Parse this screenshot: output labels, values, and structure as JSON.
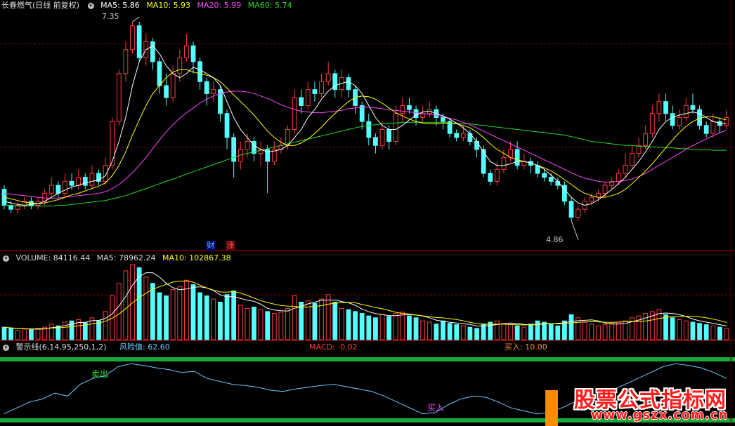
{
  "stock": {
    "name": "长春燃气",
    "mode": "(日线 前复权)"
  },
  "price_panel": {
    "ma5_label": "MA5: 5.86",
    "ma10_label": "MA10: 5.93",
    "ma20_label": "MA20: 5.99",
    "ma60_label": "MA60: 5.74",
    "high_label": "7.35",
    "low_label": "4.86",
    "event_labels": [
      "财",
      "涨"
    ]
  },
  "volume_panel": {
    "volume_label": "VOLUME: 84116.44",
    "ma5_label": "MA5: 78962.24",
    "ma10_label": "MA10: 102867.38"
  },
  "indicator_panel": {
    "name": "警示线(6,14,95,250,1,2)",
    "risk_label": "风险值: 62.60",
    "macd_label": "MACD: -0.02",
    "buy_label": "买入: 10.00",
    "sell_text": "卖出",
    "buy_text": "买入"
  },
  "watermark": {
    "line1": "股票公式指标网",
    "line2": "www.gszx.com.cn"
  },
  "colors": {
    "up": "#ff3b3b",
    "down": "#54ffff",
    "ma5": "#ffffff",
    "ma10": "#ffff00",
    "ma20": "#ff44ff",
    "ma60": "#22dd22",
    "risk": "#6ec8ff",
    "grid": "#8b0000"
  },
  "chart_data": {
    "type": "candlestick",
    "ylim": [
      4.5,
      7.5
    ],
    "candles": [
      [
        5.25,
        5.05,
        5.3,
        5.0
      ],
      [
        5.05,
        5.0,
        5.1,
        4.95
      ],
      [
        5.0,
        5.05,
        5.1,
        4.95
      ],
      [
        5.05,
        5.1,
        5.15,
        5.0
      ],
      [
        5.1,
        5.05,
        5.15,
        5.0
      ],
      [
        5.05,
        5.1,
        5.15,
        5.0
      ],
      [
        5.1,
        5.2,
        5.25,
        5.05
      ],
      [
        5.2,
        5.3,
        5.4,
        5.15
      ],
      [
        5.3,
        5.2,
        5.35,
        5.15
      ],
      [
        5.2,
        5.35,
        5.45,
        5.15
      ],
      [
        5.35,
        5.3,
        5.45,
        5.25
      ],
      [
        5.3,
        5.4,
        5.5,
        5.25
      ],
      [
        5.4,
        5.3,
        5.45,
        5.25
      ],
      [
        5.3,
        5.45,
        5.55,
        5.25
      ],
      [
        5.45,
        5.35,
        5.5,
        5.3
      ],
      [
        5.35,
        5.55,
        5.65,
        5.3
      ],
      [
        5.55,
        6.1,
        6.15,
        5.5
      ],
      [
        6.1,
        6.7,
        6.75,
        6.05
      ],
      [
        6.7,
        7.0,
        7.1,
        6.6
      ],
      [
        7.0,
        7.3,
        7.35,
        6.95
      ],
      [
        7.3,
        6.9,
        7.35,
        6.85
      ],
      [
        6.9,
        7.1,
        7.2,
        6.8
      ],
      [
        7.1,
        6.85,
        7.15,
        6.75
      ],
      [
        6.85,
        6.55,
        6.9,
        6.45
      ],
      [
        6.55,
        6.4,
        6.7,
        6.3
      ],
      [
        6.4,
        6.7,
        6.8,
        6.35
      ],
      [
        6.7,
        6.9,
        7.0,
        6.6
      ],
      [
        6.9,
        7.05,
        7.2,
        6.85
      ],
      [
        7.05,
        6.85,
        7.1,
        6.7
      ],
      [
        6.85,
        6.6,
        6.9,
        6.5
      ],
      [
        6.6,
        6.45,
        6.65,
        6.3
      ],
      [
        6.45,
        6.5,
        6.6,
        6.35
      ],
      [
        6.5,
        6.2,
        6.55,
        6.1
      ],
      [
        6.2,
        5.9,
        6.25,
        5.75
      ],
      [
        5.9,
        5.6,
        5.95,
        5.4
      ],
      [
        5.6,
        5.75,
        5.85,
        5.5
      ],
      [
        5.75,
        5.85,
        5.95,
        5.65
      ],
      [
        5.85,
        5.7,
        5.9,
        5.6
      ],
      [
        5.7,
        5.75,
        5.85,
        5.55
      ],
      [
        5.75,
        5.6,
        5.8,
        5.2
      ],
      [
        5.6,
        5.75,
        5.85,
        5.55
      ],
      [
        5.75,
        5.8,
        5.9,
        5.7
      ],
      [
        5.8,
        6.0,
        6.05,
        5.75
      ],
      [
        6.0,
        6.4,
        6.5,
        5.95
      ],
      [
        6.4,
        6.3,
        6.5,
        6.2
      ],
      [
        6.3,
        6.5,
        6.6,
        6.25
      ],
      [
        6.5,
        6.45,
        6.6,
        6.35
      ],
      [
        6.45,
        6.6,
        6.7,
        6.4
      ],
      [
        6.6,
        6.7,
        6.85,
        6.55
      ],
      [
        6.7,
        6.5,
        6.75,
        6.4
      ],
      [
        6.5,
        6.65,
        6.75,
        6.4
      ],
      [
        6.65,
        6.5,
        6.7,
        6.4
      ],
      [
        6.5,
        6.3,
        6.55,
        6.2
      ],
      [
        6.3,
        6.1,
        6.35,
        6.0
      ],
      [
        6.1,
        5.9,
        6.2,
        5.8
      ],
      [
        5.9,
        5.8,
        5.95,
        5.7
      ],
      [
        5.8,
        6.0,
        6.1,
        5.75
      ],
      [
        6.0,
        5.85,
        6.05,
        5.75
      ],
      [
        5.85,
        6.2,
        6.3,
        5.8
      ],
      [
        6.2,
        6.3,
        6.4,
        6.1
      ],
      [
        6.3,
        6.25,
        6.4,
        6.2
      ],
      [
        6.25,
        6.15,
        6.3,
        6.05
      ],
      [
        6.15,
        6.2,
        6.3,
        6.1
      ],
      [
        6.2,
        6.25,
        6.35,
        6.15
      ],
      [
        6.25,
        6.15,
        6.3,
        6.05
      ],
      [
        6.15,
        6.1,
        6.2,
        6.0
      ],
      [
        6.1,
        5.95,
        6.15,
        5.9
      ],
      [
        5.95,
        5.9,
        6.0,
        5.85
      ],
      [
        5.9,
        5.95,
        6.05,
        5.85
      ],
      [
        5.95,
        5.85,
        6.0,
        5.8
      ],
      [
        5.85,
        5.75,
        5.9,
        5.65
      ],
      [
        5.75,
        5.45,
        5.8,
        5.4
      ],
      [
        5.45,
        5.35,
        5.5,
        5.3
      ],
      [
        5.35,
        5.5,
        5.6,
        5.3
      ],
      [
        5.5,
        5.65,
        5.75,
        5.45
      ],
      [
        5.65,
        5.75,
        5.85,
        5.6
      ],
      [
        5.75,
        5.55,
        5.85,
        5.5
      ],
      [
        5.55,
        5.6,
        5.7,
        5.5
      ],
      [
        5.6,
        5.55,
        5.65,
        5.45
      ],
      [
        5.55,
        5.45,
        5.6,
        5.4
      ],
      [
        5.45,
        5.4,
        5.5,
        5.35
      ],
      [
        5.4,
        5.35,
        5.45,
        5.3
      ],
      [
        5.35,
        5.3,
        5.4,
        5.25
      ],
      [
        5.3,
        5.1,
        5.35,
        5.05
      ],
      [
        5.1,
        4.9,
        5.15,
        4.86
      ],
      [
        4.9,
        5.0,
        5.05,
        4.86
      ],
      [
        5.0,
        5.1,
        5.15,
        4.95
      ],
      [
        5.1,
        5.15,
        5.2,
        5.05
      ],
      [
        5.15,
        5.2,
        5.25,
        5.1
      ],
      [
        5.2,
        5.3,
        5.35,
        5.15
      ],
      [
        5.3,
        5.35,
        5.4,
        5.25
      ],
      [
        5.35,
        5.45,
        5.5,
        5.3
      ],
      [
        5.45,
        5.55,
        5.7,
        5.4
      ],
      [
        5.55,
        5.7,
        5.8,
        5.5
      ],
      [
        5.7,
        5.8,
        5.9,
        5.65
      ],
      [
        5.8,
        5.95,
        6.05,
        5.75
      ],
      [
        5.95,
        6.2,
        6.3,
        5.9
      ],
      [
        6.2,
        6.35,
        6.45,
        6.1
      ],
      [
        6.35,
        6.2,
        6.45,
        6.1
      ],
      [
        6.2,
        6.05,
        6.3,
        6.0
      ],
      [
        6.05,
        6.15,
        6.25,
        6.0
      ],
      [
        6.15,
        6.3,
        6.4,
        6.1
      ],
      [
        6.3,
        6.25,
        6.45,
        6.2
      ],
      [
        6.25,
        6.05,
        6.3,
        6.0
      ],
      [
        6.05,
        5.95,
        6.1,
        5.9
      ],
      [
        5.95,
        6.1,
        6.2,
        5.9
      ],
      [
        6.1,
        6.05,
        6.15,
        5.95
      ],
      [
        6.05,
        6.15,
        6.25,
        6.0
      ]
    ],
    "ma5": [
      5.1,
      5.08,
      5.06,
      5.05,
      5.06,
      5.07,
      5.1,
      5.15,
      5.2,
      5.24,
      5.28,
      5.3,
      5.33,
      5.35,
      5.37,
      5.42,
      5.6,
      5.85,
      6.15,
      6.55,
      6.85,
      7.0,
      7.05,
      6.95,
      6.8,
      6.7,
      6.65,
      6.7,
      6.78,
      6.75,
      6.7,
      6.65,
      6.55,
      6.35,
      6.15,
      6.0,
      5.9,
      5.8,
      5.75,
      5.72,
      5.73,
      5.75,
      5.8,
      5.9,
      6.0,
      6.15,
      6.25,
      6.38,
      6.48,
      6.55,
      6.58,
      6.6,
      6.55,
      6.45,
      6.3,
      6.15,
      6.05,
      6.0,
      6.0,
      6.05,
      6.12,
      6.18,
      6.22,
      6.23,
      6.2,
      6.17,
      6.13,
      6.08,
      6.02,
      5.95,
      5.85,
      5.72,
      5.6,
      5.55,
      5.55,
      5.57,
      5.6,
      5.6,
      5.58,
      5.55,
      5.5,
      5.43,
      5.35,
      5.25,
      5.15,
      5.08,
      5.05,
      5.07,
      5.12,
      5.18,
      5.25,
      5.32,
      5.4,
      5.5,
      5.6,
      5.72,
      5.85,
      6.0,
      6.1,
      6.15,
      6.18,
      6.2,
      6.22,
      6.2,
      6.15,
      6.1,
      6.08,
      6.07
    ],
    "ma10": [
      5.15,
      5.13,
      5.11,
      5.09,
      5.08,
      5.07,
      5.08,
      5.1,
      5.12,
      5.15,
      5.18,
      5.2,
      5.23,
      5.26,
      5.29,
      5.33,
      5.42,
      5.55,
      5.72,
      5.93,
      6.12,
      6.3,
      6.45,
      6.55,
      6.65,
      6.72,
      6.75,
      6.75,
      6.72,
      6.7,
      6.68,
      6.65,
      6.6,
      6.52,
      6.43,
      6.35,
      6.27,
      6.18,
      6.08,
      5.98,
      5.9,
      5.84,
      5.8,
      5.8,
      5.83,
      5.88,
      5.95,
      6.03,
      6.12,
      6.2,
      6.28,
      6.35,
      6.4,
      6.42,
      6.41,
      6.38,
      6.33,
      6.27,
      6.21,
      6.17,
      6.13,
      6.1,
      6.08,
      6.07,
      6.07,
      6.08,
      6.08,
      6.07,
      6.05,
      6.02,
      5.97,
      5.9,
      5.82,
      5.75,
      5.7,
      5.65,
      5.62,
      5.6,
      5.58,
      5.55,
      5.52,
      5.48,
      5.43,
      5.37,
      5.31,
      5.25,
      5.2,
      5.17,
      5.15,
      5.15,
      5.17,
      5.2,
      5.25,
      5.32,
      5.4,
      5.48,
      5.57,
      5.67,
      5.77,
      5.87,
      5.96,
      6.04,
      6.1,
      6.14,
      6.16,
      6.16,
      6.14,
      6.12
    ],
    "ma20": [
      5.2,
      5.19,
      5.18,
      5.17,
      5.16,
      5.15,
      5.14,
      5.14,
      5.14,
      5.15,
      5.16,
      5.17,
      5.18,
      5.19,
      5.2,
      5.22,
      5.26,
      5.31,
      5.38,
      5.46,
      5.55,
      5.65,
      5.76,
      5.87,
      5.97,
      6.06,
      6.14,
      6.21,
      6.27,
      6.33,
      6.38,
      6.42,
      6.45,
      6.47,
      6.48,
      6.48,
      6.47,
      6.45,
      6.42,
      6.39,
      6.35,
      6.31,
      6.28,
      6.25,
      6.23,
      6.22,
      6.21,
      6.21,
      6.22,
      6.23,
      6.24,
      6.26,
      6.27,
      6.28,
      6.28,
      6.27,
      6.26,
      6.25,
      6.24,
      6.23,
      6.22,
      6.21,
      6.2,
      6.19,
      6.18,
      6.16,
      6.14,
      6.12,
      6.09,
      6.06,
      6.02,
      5.98,
      5.94,
      5.9,
      5.86,
      5.82,
      5.78,
      5.74,
      5.7,
      5.66,
      5.62,
      5.58,
      5.54,
      5.5,
      5.46,
      5.42,
      5.39,
      5.37,
      5.35,
      5.34,
      5.34,
      5.35,
      5.36,
      5.38,
      5.41,
      5.45,
      5.5,
      5.55,
      5.6,
      5.65,
      5.7,
      5.75,
      5.8,
      5.84,
      5.88,
      5.92,
      5.96,
      5.99
    ],
    "ma60": [
      5.05,
      5.05,
      5.04,
      5.04,
      5.04,
      5.04,
      5.04,
      5.04,
      5.05,
      5.05,
      5.06,
      5.07,
      5.08,
      5.09,
      5.1,
      5.11,
      5.13,
      5.15,
      5.17,
      5.2,
      5.23,
      5.26,
      5.29,
      5.32,
      5.35,
      5.38,
      5.41,
      5.44,
      5.47,
      5.5,
      5.53,
      5.56,
      5.59,
      5.62,
      5.65,
      5.68,
      5.7,
      5.72,
      5.74,
      5.76,
      5.78,
      5.8,
      5.82,
      5.84,
      5.86,
      5.88,
      5.9,
      5.92,
      5.94,
      5.96,
      5.98,
      6.0,
      6.02,
      6.04,
      6.05,
      6.06,
      6.07,
      6.08,
      6.08,
      6.09,
      6.09,
      6.09,
      6.09,
      6.09,
      6.09,
      6.09,
      6.08,
      6.08,
      6.07,
      6.07,
      6.06,
      6.05,
      6.04,
      6.03,
      6.02,
      6.01,
      6.0,
      5.99,
      5.98,
      5.97,
      5.96,
      5.95,
      5.94,
      5.93,
      5.91,
      5.89,
      5.87,
      5.85,
      5.84,
      5.83,
      5.82,
      5.81,
      5.8,
      5.8,
      5.79,
      5.79,
      5.78,
      5.78,
      5.77,
      5.77,
      5.76,
      5.76,
      5.75,
      5.75,
      5.75,
      5.74,
      5.74,
      5.74
    ],
    "volume": [
      20,
      18,
      15,
      17,
      16,
      18,
      20,
      25,
      22,
      28,
      30,
      32,
      27,
      35,
      30,
      45,
      70,
      90,
      110,
      120,
      115,
      100,
      90,
      75,
      70,
      80,
      85,
      95,
      88,
      75,
      70,
      65,
      60,
      72,
      78,
      55,
      50,
      52,
      48,
      45,
      42,
      44,
      50,
      70,
      60,
      62,
      58,
      65,
      72,
      60,
      50,
      48,
      45,
      42,
      38,
      35,
      40,
      37,
      42,
      44,
      38,
      35,
      30,
      28,
      25,
      30,
      26,
      24,
      22,
      20,
      18,
      25,
      28,
      30,
      26,
      24,
      22,
      20,
      25,
      30,
      28,
      25,
      22,
      30,
      40,
      35,
      28,
      25,
      22,
      24,
      26,
      28,
      30,
      35,
      38,
      42,
      45,
      48,
      40,
      35,
      32,
      30,
      28,
      26,
      24,
      22,
      20,
      18
    ],
    "risk_value": [
      10,
      20,
      30,
      35,
      45,
      40,
      60,
      70,
      75,
      90,
      95,
      92,
      88,
      85,
      80,
      82,
      70,
      65,
      60,
      58,
      55,
      50,
      48,
      52,
      55,
      58,
      60,
      56,
      52,
      48,
      40,
      30,
      20,
      10,
      12,
      25,
      35,
      40,
      38,
      30,
      20,
      15,
      10,
      12,
      20,
      30,
      40,
      45,
      50,
      60,
      70,
      80,
      90,
      95,
      92,
      88,
      80,
      70
    ]
  }
}
